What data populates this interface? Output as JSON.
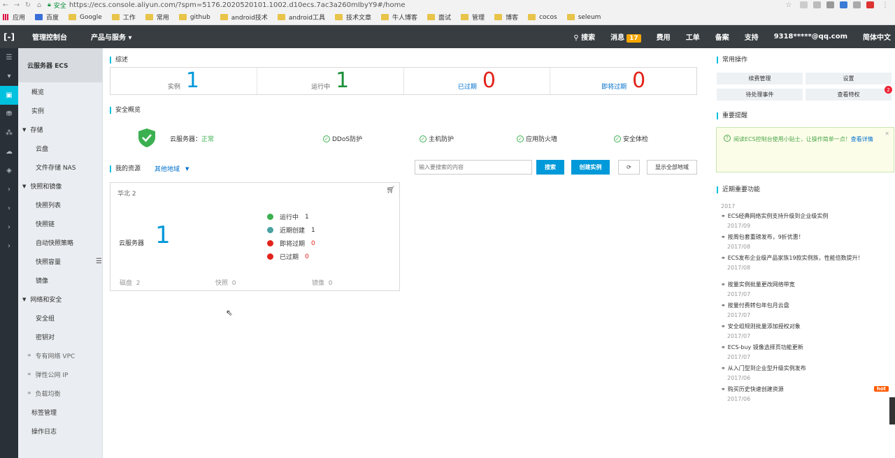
{
  "browser": {
    "security_label": "安全",
    "url": "https://ecs.console.aliyun.com/?spm=5176.2020520101.1002.d10ecs.7ac3a260mIbyY9#/home",
    "bookmarks": [
      "应用",
      "百度",
      "Google",
      "工作",
      "常用",
      "github",
      "android技术",
      "android工具",
      "技术文章",
      "牛人博客",
      "面试",
      "管理",
      "博客",
      "cocos",
      "seleum"
    ]
  },
  "topbar": {
    "console": "管理控制台",
    "products": "产品与服务",
    "search": "搜索",
    "messages": "消息",
    "msg_count": "17",
    "billing": "费用",
    "tickets": "工单",
    "beian": "备案",
    "support": "支持",
    "account": "9318*****@qq.com",
    "lang": "简体中文"
  },
  "sidebar": {
    "title": "云服务器 ECS",
    "overview": "概览",
    "instances": "实例",
    "storage": "存储",
    "disks": "云盘",
    "nas": "文件存储 NAS",
    "snapshots": "快照和镜像",
    "snap_list": "快照列表",
    "snap_chain": "快照链",
    "auto_snap": "自动快照策略",
    "snap_cap": "快照容量",
    "images": "镜像",
    "network": "网络和安全",
    "sg": "安全组",
    "keypair": "密钥对",
    "vpc": "专有网络 VPC",
    "eip": "弹性公网 IP",
    "slb": "负载均衡",
    "tags": "标签管理",
    "oplog": "操作日志"
  },
  "summary": {
    "title": "综述",
    "items": [
      {
        "label": "实例",
        "value": "1",
        "color": "#0099d9"
      },
      {
        "label": "运行中",
        "value": "1",
        "color": "#1a8f37"
      },
      {
        "label": "已过期",
        "value": "0",
        "color": "#e2231a"
      },
      {
        "label": "即将过期",
        "value": "0",
        "color": "#e2231a"
      }
    ]
  },
  "security": {
    "title": "安全概览",
    "server_label": "云服务器：",
    "server_status": "正常",
    "items": [
      "DDoS防护",
      "主机防护",
      "应用防火墙",
      "安全体检"
    ]
  },
  "resources": {
    "title": "我的资源",
    "other_region": "其他地域",
    "search_placeholder": "输入要搜索的内容",
    "search_btn": "搜索",
    "create_btn": "创建实例",
    "show_all_btn": "显示全部地域"
  },
  "card": {
    "region": "华北 2",
    "server_label": "云服务器",
    "server_count": "1",
    "stats": [
      {
        "label": "运行中",
        "value": "1",
        "color": "#3cb050"
      },
      {
        "label": "近期创建",
        "value": "1",
        "color": "#4aa3a3"
      },
      {
        "label": "即将过期",
        "value": "0",
        "color": "#e2231a"
      },
      {
        "label": "已过期",
        "value": "0",
        "color": "#e2231a"
      }
    ],
    "disk_label": "磁盘",
    "disk_value": "2",
    "snap_label": "快照",
    "snap_value": "0",
    "image_label": "镜像",
    "image_value": "0"
  },
  "ops": {
    "title": "常用操作",
    "renew": "续费管理",
    "settings": "设置",
    "pending": "待处理事件",
    "privileges": "查看特权",
    "priv_badge": "2"
  },
  "notice": {
    "title": "重要提醒",
    "text": "阅读ECS控制台使用小贴士，让操作简单一点！",
    "link": "查看详情"
  },
  "features": {
    "title": "近期重要功能",
    "year": "2017",
    "items": [
      {
        "text": "ECS经典网络实例支持升级到企业级实例",
        "date": "2017/09"
      },
      {
        "text": "按周包套重磅发布，9折优惠！",
        "date": "2017/08"
      },
      {
        "text": "ECS发布企业级产品家族19款实例族，性能倍数提升！",
        "date": "2017/08"
      },
      {
        "text": "按量实例批量更改网络带宽",
        "date": "2017/07"
      },
      {
        "text": "按量付费转包年包月云盘",
        "date": "2017/07"
      },
      {
        "text": "安全组规则批量添加授权对象",
        "date": "2017/07"
      },
      {
        "text": "ECS-buy 镜像选择页功能更新",
        "date": "2017/07"
      },
      {
        "text": "从入门型到企业型升级实例发布",
        "date": "2017/06"
      },
      {
        "text": "购买历史快速创建资源",
        "date": "2017/06",
        "hot": "hot"
      }
    ]
  }
}
